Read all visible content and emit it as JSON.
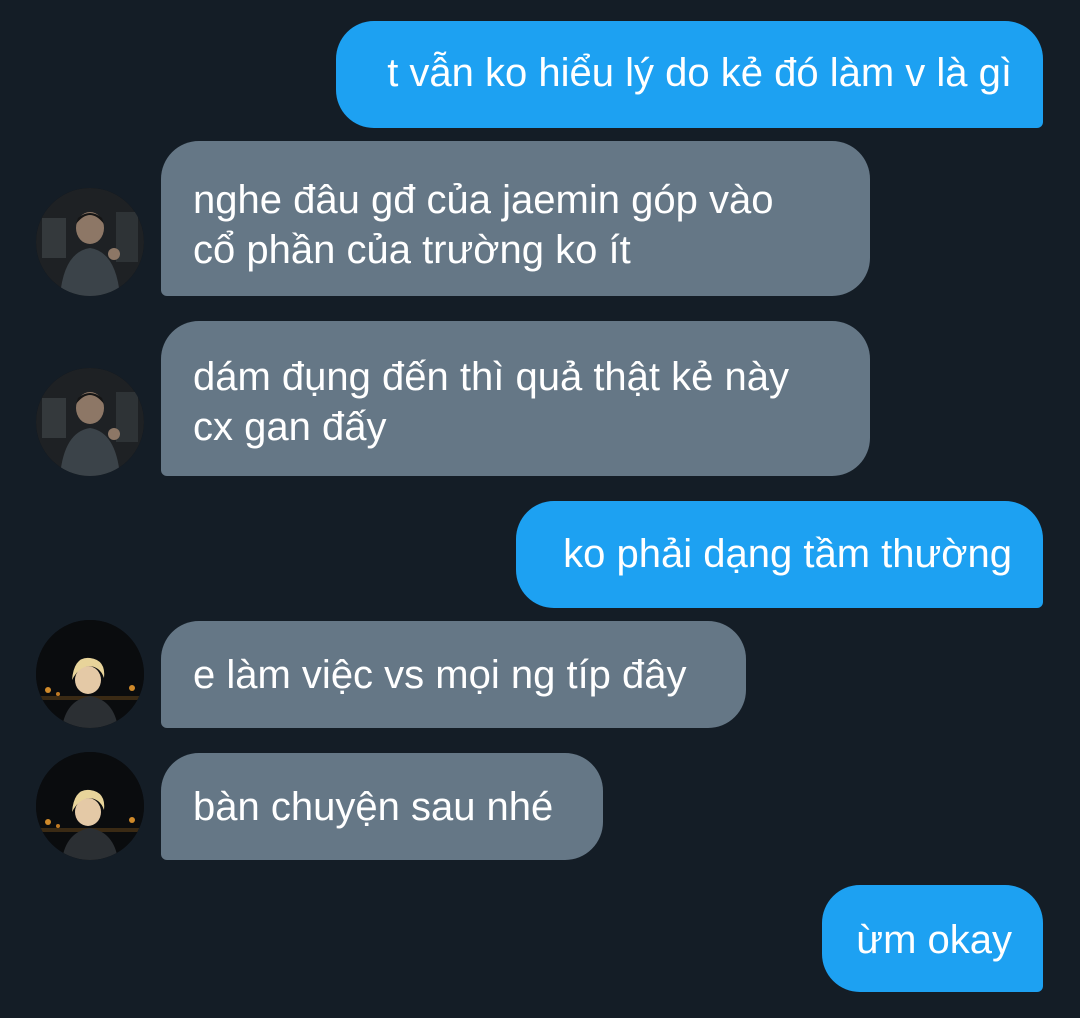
{
  "conversation": {
    "messages": [
      {
        "id": "m1",
        "direction": "outgoing",
        "lines": [
          "t vẫn ko hiểu lý do kẻ đó làm v là gì"
        ]
      },
      {
        "id": "m2",
        "direction": "incoming",
        "sender_avatar": "avatar-dark-hair",
        "lines": [
          "nghe đâu gđ của jaemin góp vào",
          "cổ phần của trường ko ít"
        ]
      },
      {
        "id": "m3",
        "direction": "incoming",
        "sender_avatar": "avatar-dark-hair",
        "lines": [
          "dám đụng đến thì quả thật kẻ này",
          "cx gan đấy"
        ]
      },
      {
        "id": "m4",
        "direction": "outgoing",
        "lines": [
          "ko phải dạng tầm thường"
        ]
      },
      {
        "id": "m5",
        "direction": "incoming",
        "sender_avatar": "avatar-blonde-hair",
        "lines": [
          "e làm việc vs mọi ng típ đây"
        ]
      },
      {
        "id": "m6",
        "direction": "incoming",
        "sender_avatar": "avatar-blonde-hair",
        "lines": [
          "bàn chuyện sau nhé"
        ]
      },
      {
        "id": "m7",
        "direction": "outgoing",
        "lines": [
          "ừm okay"
        ]
      }
    ]
  },
  "colors": {
    "background": "#141d26",
    "outgoing_bubble": "#1da1f2",
    "incoming_bubble": "#657786",
    "text": "#ffffff"
  }
}
